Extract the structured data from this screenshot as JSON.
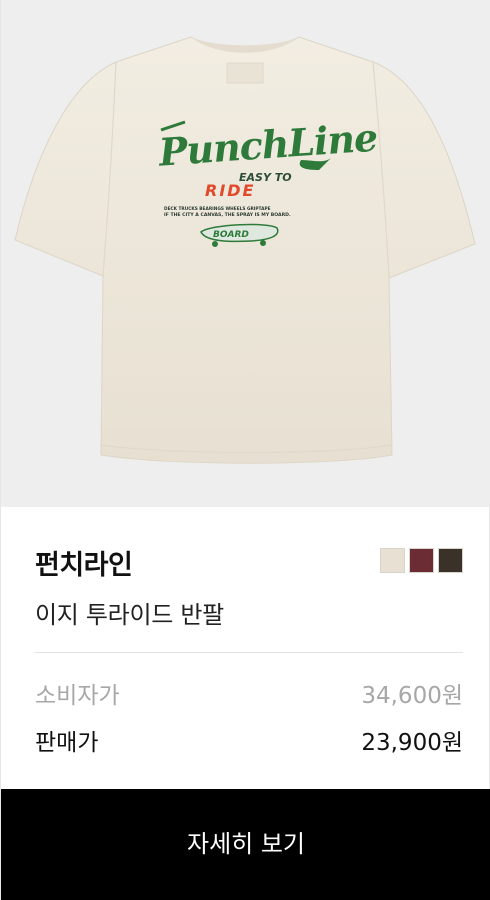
{
  "product": {
    "brand": "펀치라인",
    "name": "이지 투라이드 반팔",
    "image_alt": "Punch Line EASY TO RIDE 반팔 티셔츠",
    "print": {
      "logo": "PunchLine",
      "tagline_1": "EASY TO",
      "tagline_2": "RIDE",
      "parts_line": "DECK   TRUCKS   BEARINGS   WHEELS   GRIPTAPE",
      "slogan": "IF THE CITY A CANVAS, THE SPRAY IS MY BOARD.",
      "board": "BOARD"
    },
    "swatches": [
      {
        "name": "ivory-swatch",
        "color": "#e8e0d3"
      },
      {
        "name": "burgundy-swatch",
        "color": "#6b2c33"
      },
      {
        "name": "charcoal-brown-swatch",
        "color": "#3a3129"
      }
    ]
  },
  "pricing": {
    "retail_label": "소비자가",
    "retail_price": "34,600원",
    "sale_label": "판매가",
    "sale_price": "23,900원"
  },
  "cta": {
    "label": "자세히 보기"
  },
  "colors": {
    "shirt": "#efe9dd",
    "logo_green": "#2e7a3a",
    "ride_red": "#e0492a",
    "button_bg": "#000000"
  }
}
